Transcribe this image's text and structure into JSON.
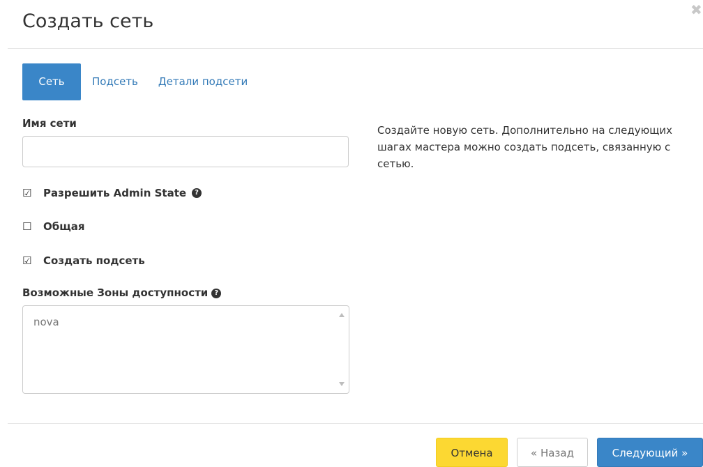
{
  "modal": {
    "title": "Создать сеть",
    "close_icon": "close-icon"
  },
  "tabs": [
    {
      "label": "Сеть",
      "active": true
    },
    {
      "label": "Подсеть",
      "active": false
    },
    {
      "label": "Детали подсети",
      "active": false
    }
  ],
  "form": {
    "network_name": {
      "label": "Имя сети",
      "value": "",
      "placeholder": ""
    },
    "admin_state": {
      "label": "Разрешить Admin State",
      "checked": true,
      "checkbox_glyph": "☑",
      "help_glyph": "?"
    },
    "shared": {
      "label": "Общая",
      "checked": false,
      "checkbox_glyph": "☐"
    },
    "create_subnet": {
      "label": "Создать подсеть",
      "checked": true,
      "checkbox_glyph": "☑"
    },
    "availability_zones": {
      "label": "Возможные Зоны доступности",
      "help_glyph": "?",
      "options": [
        "nova"
      ]
    }
  },
  "help": {
    "text": "Создайте новую сеть. Дополнительно на следующих шагах мастера можно создать подсеть, связанную с сетью."
  },
  "footer": {
    "cancel_label": "Отмена",
    "back_label": "« Назад",
    "next_label": "Следующий »"
  },
  "colors": {
    "primary": "#3a86c8",
    "warning": "#fcd832",
    "link": "#337ab7"
  }
}
